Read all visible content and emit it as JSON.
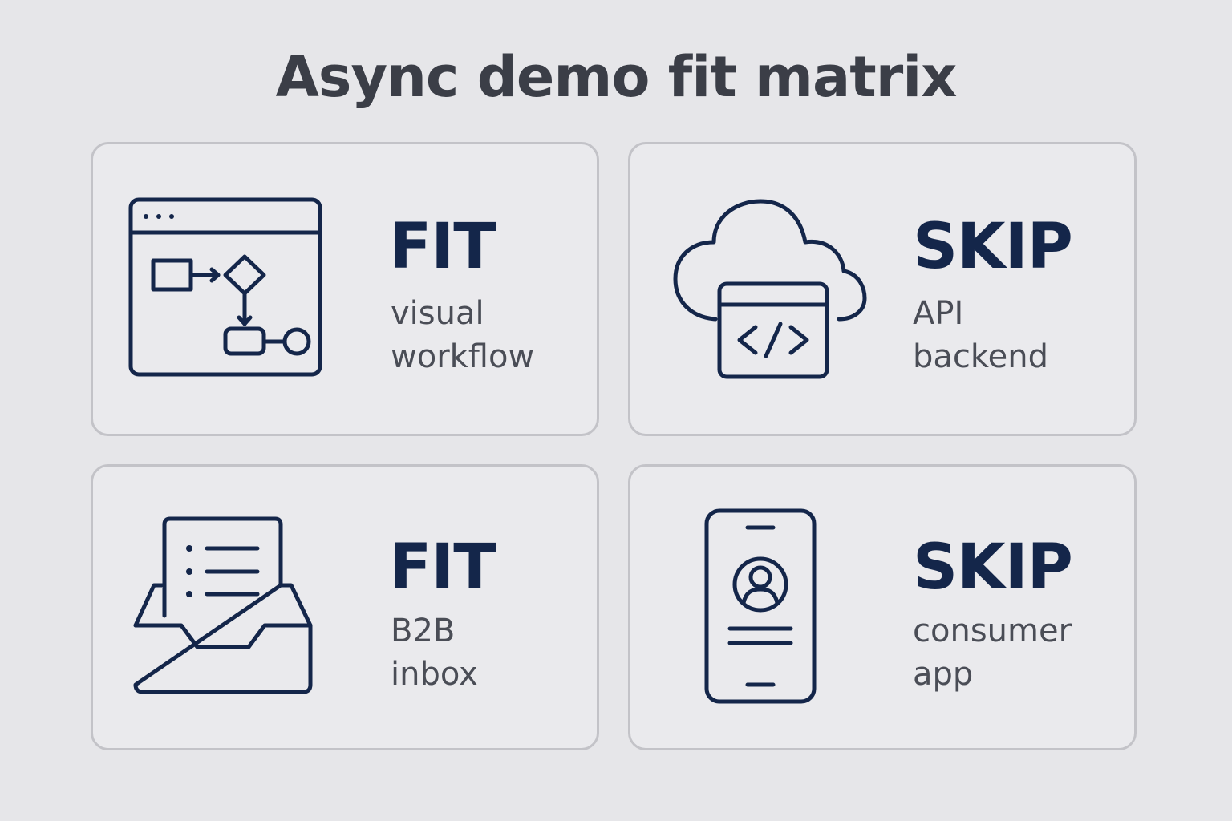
{
  "title": "Async demo fit matrix",
  "colors": {
    "background": "#e6e6e9",
    "card_border": "#c3c3c8",
    "card_fill": "#eaeaed",
    "icon_stroke": "#14264a",
    "verdict_text": "#14264a",
    "title_text": "#3b3e47",
    "desc_text": "#4a4d56"
  },
  "cards": [
    {
      "verdict": "FIT",
      "desc_lines": [
        "visual",
        "workflow"
      ],
      "icon": "workflow-window-icon"
    },
    {
      "verdict": "SKIP",
      "desc_lines": [
        "API",
        "backend"
      ],
      "icon": "cloud-code-icon"
    },
    {
      "verdict": "FIT",
      "desc_lines": [
        "B2B",
        "inbox"
      ],
      "icon": "inbox-tray-icon"
    },
    {
      "verdict": "SKIP",
      "desc_lines": [
        "consumer",
        "app"
      ],
      "icon": "mobile-profile-icon"
    }
  ]
}
